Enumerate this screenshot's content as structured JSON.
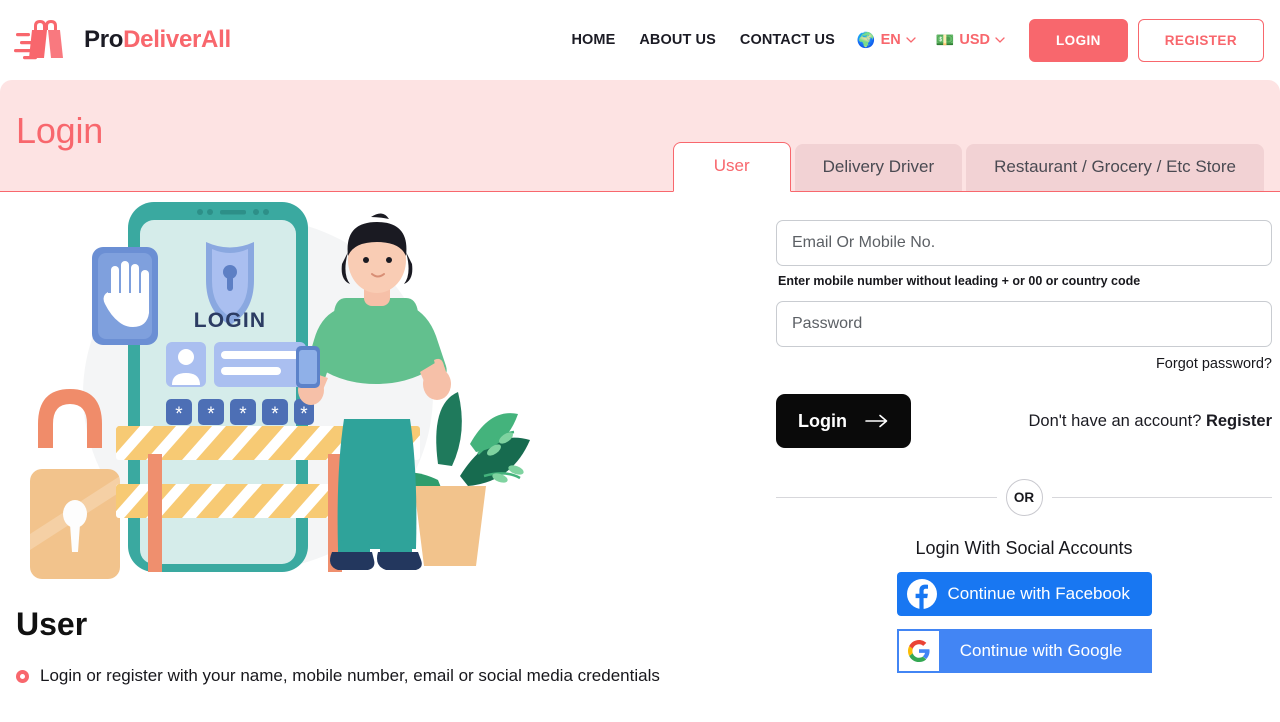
{
  "header": {
    "logo": {
      "part1": "Pro",
      "part2": "DeliverAll",
      "icon": "shopping-bag-icon"
    },
    "nav": [
      {
        "label": "HOME"
      },
      {
        "label": "ABOUT US"
      },
      {
        "label": "CONTACT US"
      }
    ],
    "language": {
      "value": "EN",
      "icon": "globe-icon",
      "chevron": "chevron-down-icon"
    },
    "currency": {
      "value": "USD",
      "icon": "banknote-icon",
      "chevron": "chevron-down-icon"
    },
    "login_button": "LOGIN",
    "register_button": "REGISTER"
  },
  "banner": {
    "title": "Login",
    "tabs": [
      {
        "label": "User",
        "active": true
      },
      {
        "label": "Delivery Driver",
        "active": false
      },
      {
        "label": "Restaurant / Grocery / Etc Store",
        "active": false
      }
    ]
  },
  "illustration": {
    "name": "login-security-illustration",
    "phone_label": "LOGIN"
  },
  "form": {
    "email": {
      "placeholder": "Email Or Mobile No.",
      "value": ""
    },
    "helper": "Enter mobile number without leading + or 00 or country code",
    "password": {
      "placeholder": "Password",
      "value": ""
    },
    "forgot": "Forgot password?",
    "submit": "Login",
    "register_prompt": "Don't have an account? ",
    "register_link": "Register",
    "or": "OR",
    "social_title": "Login With Social Accounts",
    "facebook": "Continue with Facebook",
    "google": "Continue with Google"
  },
  "info": {
    "heading": "User",
    "bullets": [
      "Login or register with your name, mobile number, email or social media credentials"
    ]
  },
  "colors": {
    "accent": "#f8676d",
    "banner_bg": "#fde3e3",
    "tab_inactive_bg": "#f2d2d4",
    "facebook_blue": "#1877f2",
    "google_blue": "#4285f4",
    "login_black": "#0a0a0a"
  }
}
